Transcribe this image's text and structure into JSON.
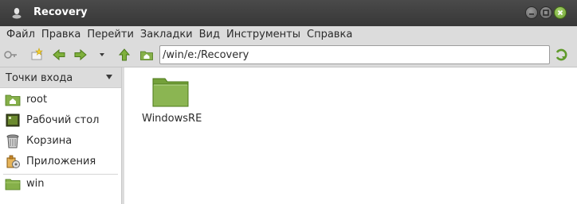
{
  "window": {
    "title": "Recovery"
  },
  "menu": [
    "Файл",
    "Правка",
    "Перейти",
    "Закладки",
    "Вид",
    "Инструменты",
    "Справка"
  ],
  "location": {
    "path": "/win/e:/Recovery"
  },
  "sidepane": {
    "header": "Точки входа",
    "places": [
      {
        "label": "root",
        "icon": "home-folder-icon"
      },
      {
        "label": "Рабочий стол",
        "icon": "desktop-icon"
      },
      {
        "label": "Корзина",
        "icon": "trash-icon"
      },
      {
        "label": "Приложения",
        "icon": "applications-icon"
      }
    ],
    "bookmarks": [
      {
        "label": "win",
        "icon": "folder-icon"
      }
    ]
  },
  "files": [
    {
      "name": "WindowsRE",
      "icon": "folder-icon"
    }
  ],
  "colors": {
    "titlebar": "#3f3f3f",
    "accent_green": "#6fa034",
    "folder": "#86b04a"
  }
}
